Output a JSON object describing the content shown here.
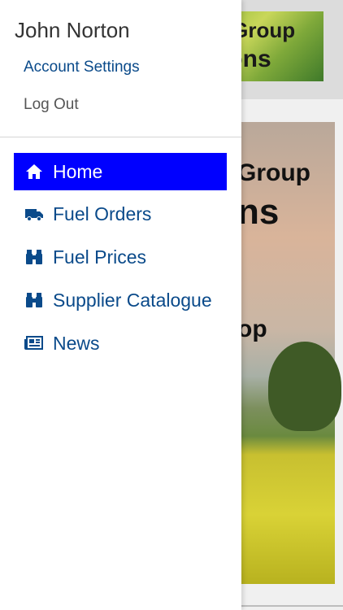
{
  "background": {
    "header_line1": "g Group",
    "header_line2": "tions",
    "hero_line1": "Group",
    "hero_line2": "ns",
    "hero_line3": "op"
  },
  "drawer": {
    "user_name": "John Norton",
    "account_settings": "Account Settings",
    "log_out": "Log Out",
    "nav": [
      {
        "label": "Home",
        "icon": "home-icon",
        "active": true
      },
      {
        "label": "Fuel Orders",
        "icon": "truck-icon",
        "active": false
      },
      {
        "label": "Fuel Prices",
        "icon": "binoculars-icon",
        "active": false
      },
      {
        "label": "Supplier Catalogue",
        "icon": "binoculars-icon",
        "active": false
      },
      {
        "label": "News",
        "icon": "newspaper-icon",
        "active": false
      }
    ]
  },
  "colors": {
    "active_bg": "#0000ff",
    "link": "#0a4a8a"
  }
}
